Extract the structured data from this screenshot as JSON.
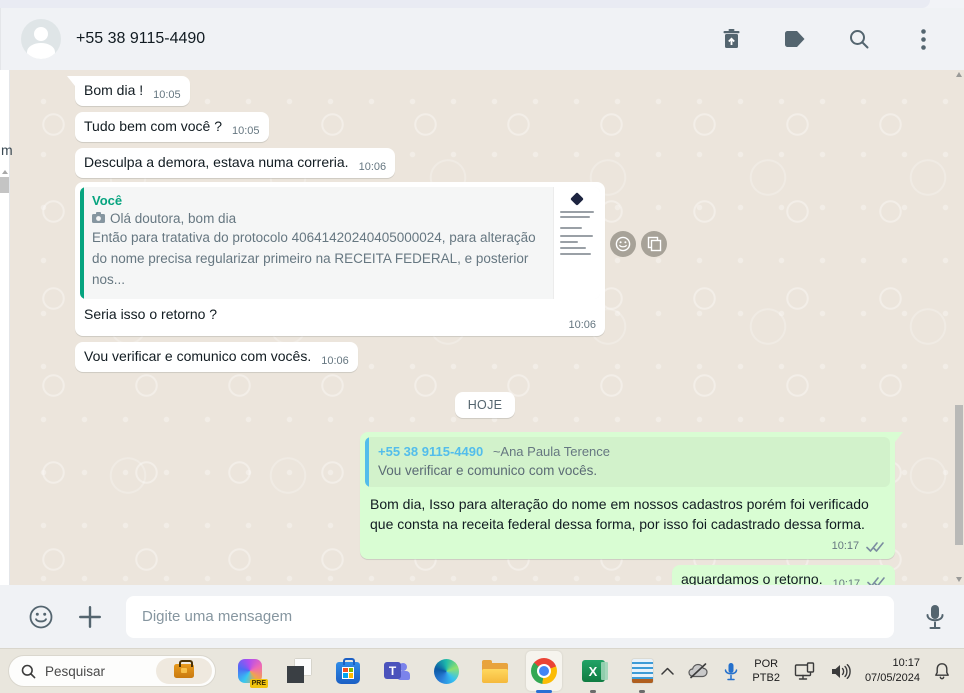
{
  "header": {
    "title": "+55 38 9115-4490",
    "icons": [
      "delete-icon",
      "label-icon",
      "search-icon",
      "menu-icon"
    ]
  },
  "chat": {
    "chatlist_edge_text": "m",
    "day_divider": "HOJE",
    "messages": [
      {
        "direction": "in",
        "text": "Bom dia !",
        "time": "10:05"
      },
      {
        "direction": "in",
        "text": "Tudo bem com você ?",
        "time": "10:05"
      },
      {
        "direction": "in",
        "text": "Desculpa a demora, estava numa correria.",
        "time": "10:06"
      },
      {
        "direction": "in",
        "quote": {
          "sender": "Você",
          "attachment_label": "Olá doutora, bom dia",
          "body": "Então para tratativa do protocolo 40641420240405000024, para alteração do nome precisa regularizar primeiro na RECEITA FEDERAL, e posterior nos..."
        },
        "text": "Seria isso o retorno ?",
        "time": "10:06"
      },
      {
        "direction": "in",
        "text": "Vou verificar e comunico com vocês.",
        "time": "10:06"
      },
      {
        "direction": "out",
        "quote": {
          "sender": "+55 38 9115-4490",
          "sender_suffix": "~Ana Paula Terence",
          "body": "Vou verificar e comunico com vocês."
        },
        "text": "Bom dia, Isso para alteração do nome em nossos cadastros porém foi verificado que consta na receita federal dessa forma, por isso foi cadastrado dessa forma.",
        "time": "10:17",
        "status": "read"
      },
      {
        "direction": "out",
        "text": "aguardamos o retorno.",
        "time": "10:17",
        "status": "read"
      }
    ]
  },
  "composer": {
    "placeholder": "Digite uma mensagem"
  },
  "taskbar": {
    "search_placeholder": "Pesquisar",
    "copilot_badge": "PRE",
    "teams_letter": "T",
    "excel_letter": "X",
    "apps": [
      "copilot",
      "frames",
      "store",
      "teams",
      "edge",
      "file-explorer",
      "chrome",
      "excel",
      "notepad"
    ],
    "tray": {
      "lang_line1": "POR",
      "lang_line2": "PTB2",
      "time": "10:17",
      "date": "07/05/2024"
    }
  },
  "colors": {
    "outgoing_bubble": "#d9fdd3",
    "incoming_bubble": "#ffffff",
    "quote_sender_self": "#06a47f",
    "quote_sender_other": "#53bdeb",
    "header_bg": "#f0f2f5",
    "chat_bg": "#ece5dc",
    "icon_gray": "#54656f",
    "check_color": "#7b8ca0"
  }
}
